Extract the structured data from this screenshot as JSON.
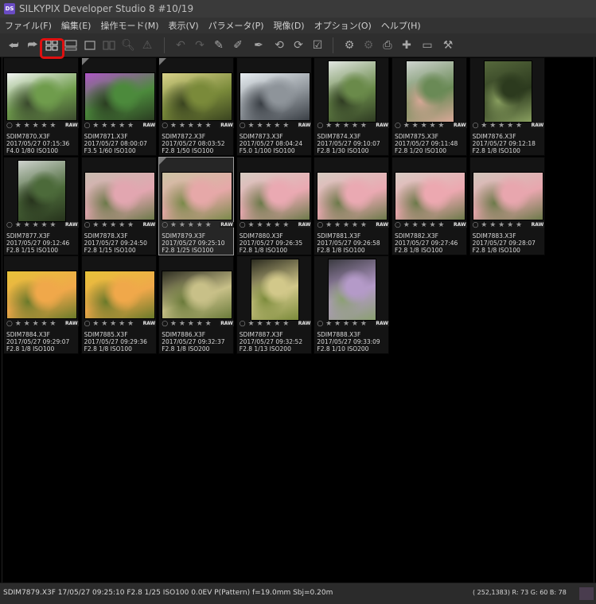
{
  "window": {
    "logo_text": "DS",
    "title": "SILKYPIX Developer Studio 8   #10/19"
  },
  "menu": [
    "ファイル(F)",
    "編集(E)",
    "操作モード(M)",
    "表示(V)",
    "パラメータ(P)",
    "現像(D)",
    "オプション(O)",
    "ヘルプ(H)"
  ],
  "toolbar": {
    "active_view": "thumbnail-grid",
    "highlight_color": "#e01010"
  },
  "thumbnails": [
    {
      "file": "SDIM7870.X3F",
      "datetime": "2017/05/27 07:15:36",
      "exposure": "F4.0 1/80 ISO100",
      "raw": "RAW",
      "orientation": "landscape",
      "scene": "street",
      "colors": [
        "#f3f5f4",
        "#6f9c4c",
        "#3b4a2e"
      ]
    },
    {
      "file": "SDIM7871.X3F",
      "datetime": "2017/05/27 08:00:07",
      "exposure": "F3.5 1/60 ISO100",
      "raw": "RAW",
      "orientation": "landscape",
      "scene": "flowers",
      "colors": [
        "#b056c8",
        "#4c8a3c",
        "#2b3e22"
      ]
    },
    {
      "file": "SDIM7872.X3F",
      "datetime": "2017/05/27 08:03:52",
      "exposure": "F2.8 1/50 ISO100",
      "raw": "RAW",
      "orientation": "landscape",
      "scene": "garden",
      "colors": [
        "#d9d28a",
        "#7a8a3a",
        "#3a4420"
      ]
    },
    {
      "file": "SDIM7873.X3F",
      "datetime": "2017/05/27 08:04:24",
      "exposure": "F5.0 1/100 ISO100",
      "raw": "RAW",
      "orientation": "landscape",
      "scene": "stairs",
      "colors": [
        "#e8eef2",
        "#8e949a",
        "#3a3f45"
      ]
    },
    {
      "file": "SDIM7874.X3F",
      "datetime": "2017/05/27 09:10:07",
      "exposure": "F2.8 1/30 ISO100",
      "raw": "RAW",
      "orientation": "portrait",
      "scene": "cactus",
      "colors": [
        "#e2e6e2",
        "#6a8a4a",
        "#2e3a22"
      ]
    },
    {
      "file": "SDIM7875.X3F",
      "datetime": "2017/05/27 09:11:48",
      "exposure": "F2.8 1/20 ISO100",
      "raw": "RAW",
      "orientation": "portrait",
      "scene": "pot",
      "colors": [
        "#cfd4d0",
        "#6a8a56",
        "#d9a898"
      ]
    },
    {
      "file": "SDIM7876.X3F",
      "datetime": "2017/05/27 09:12:18",
      "exposure": "F2.8 1/8 ISO100",
      "raw": "RAW",
      "orientation": "portrait",
      "scene": "cactus-dark",
      "colors": [
        "#56683c",
        "#2c3a1e",
        "#8aa060"
      ]
    },
    {
      "file": "SDIM7877.X3F",
      "datetime": "2017/05/27 09:12:46",
      "exposure": "F2.8 1/15 ISO100",
      "raw": "RAW",
      "orientation": "portrait",
      "scene": "cactus",
      "colors": [
        "#cfd3cf",
        "#4c6a3a",
        "#26321c"
      ]
    },
    {
      "file": "SDIM7878.X3F",
      "datetime": "2017/05/27 09:24:50",
      "exposure": "F2.8 1/15 ISO100",
      "raw": "RAW",
      "orientation": "landscape",
      "scene": "bouquet",
      "colors": [
        "#c9bcb0",
        "#e2a6b0",
        "#6c7a4a"
      ]
    },
    {
      "file": "SDIM7879.X3F",
      "datetime": "2017/05/27 09:25:10",
      "exposure": "F2.8 1/25 ISO100",
      "raw": "RAW",
      "orientation": "landscape",
      "scene": "bouquet",
      "colors": [
        "#cdc4a4",
        "#e6a8a8",
        "#7a8a4a"
      ],
      "selected": true
    },
    {
      "file": "SDIM7880.X3F",
      "datetime": "2017/05/27 09:26:35",
      "exposure": "F2.8 1/8 ISO100",
      "raw": "RAW",
      "orientation": "landscape",
      "scene": "bouquet",
      "colors": [
        "#d6ccc2",
        "#eaa9b2",
        "#6c7a4a"
      ]
    },
    {
      "file": "SDIM7881.X3F",
      "datetime": "2017/05/27 09:26:58",
      "exposure": "F2.8 1/8 ISO100",
      "raw": "RAW",
      "orientation": "landscape",
      "scene": "bouquet",
      "colors": [
        "#d6ccc2",
        "#eaa9b2",
        "#6c7a4a"
      ]
    },
    {
      "file": "SDIM7882.X3F",
      "datetime": "2017/05/27 09:27:46",
      "exposure": "F2.8 1/8 ISO100",
      "raw": "RAW",
      "orientation": "landscape",
      "scene": "bouquet",
      "colors": [
        "#d8ccc4",
        "#eca8b0",
        "#6c7a4a"
      ]
    },
    {
      "file": "SDIM7883.X3F",
      "datetime": "2017/05/27 09:28:07",
      "exposure": "F2.8 1/8 ISO100",
      "raw": "RAW",
      "orientation": "landscape",
      "scene": "bouquet",
      "colors": [
        "#d2c6bc",
        "#e8a6ae",
        "#6c7a4a"
      ]
    },
    {
      "file": "SDIM7884.X3F",
      "datetime": "2017/05/27 09:29:07",
      "exposure": "F2.8 1/8 ISO100",
      "raw": "RAW",
      "orientation": "landscape",
      "scene": "yellow-bouquet",
      "colors": [
        "#e6c23a",
        "#f0a84a",
        "#6a7a2a"
      ]
    },
    {
      "file": "SDIM7885.X3F",
      "datetime": "2017/05/27 09:29:36",
      "exposure": "F2.8 1/8 ISO100",
      "raw": "RAW",
      "orientation": "landscape",
      "scene": "yellow-bouquet",
      "colors": [
        "#e6c23a",
        "#f0a84a",
        "#6a7a2a"
      ]
    },
    {
      "file": "SDIM7886.X3F",
      "datetime": "2017/05/27 09:32:37",
      "exposure": "F2.8 1/8 ISO200",
      "raw": "RAW",
      "orientation": "landscape",
      "scene": "dark-bouquet",
      "colors": [
        "#2e2e22",
        "#c8c088",
        "#6a7a3a"
      ]
    },
    {
      "file": "SDIM7887.X3F",
      "datetime": "2017/05/27 09:32:52",
      "exposure": "F2.8 1/13 ISO200",
      "raw": "RAW",
      "orientation": "portrait",
      "scene": "dark-bouquet",
      "colors": [
        "#2c2c20",
        "#d2c88a",
        "#7a8a3a"
      ]
    },
    {
      "file": "SDIM7888.X3F",
      "datetime": "2017/05/27 09:33:09",
      "exposure": "F2.8 1/10 ISO200",
      "raw": "RAW",
      "orientation": "portrait",
      "scene": "purple-bouquet",
      "colors": [
        "#3a3a40",
        "#b49ac8",
        "#8aa070"
      ]
    }
  ],
  "rating": {
    "dot": "○",
    "stars": "★ ★ ★ ★ ★"
  },
  "status": {
    "file_info": "SDIM7879.X3F 17/05/27 09:25:10 F2.8 1/25 ISO100  0.0EV P(Pattern) f=19.0mm Sbj=0.20m",
    "pixel_info": "( 252,1383) R: 73 G: 60 B: 78",
    "swatch_color": "#493c4e"
  }
}
